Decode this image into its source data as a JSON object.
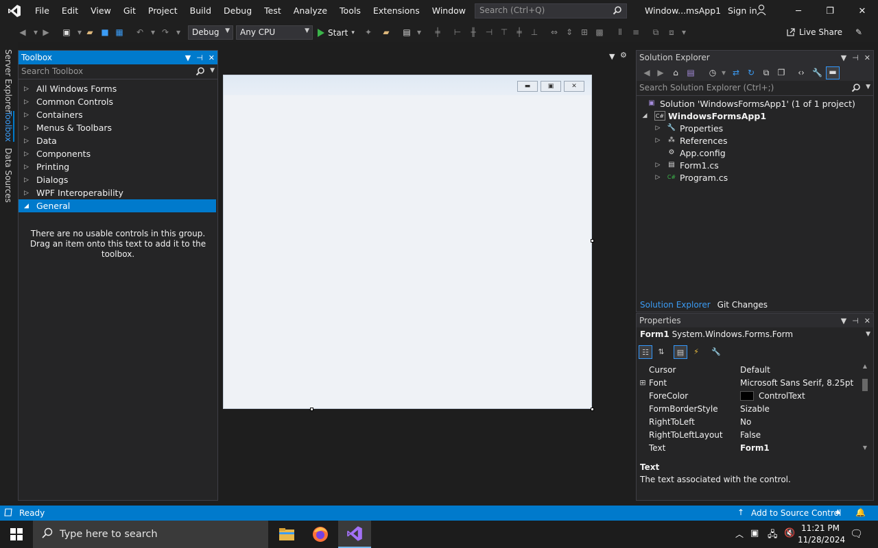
{
  "menu": {
    "items": [
      "File",
      "Edit",
      "View",
      "Git",
      "Project",
      "Build",
      "Debug",
      "Test",
      "Analyze",
      "Tools",
      "Extensions",
      "Window",
      "Help"
    ],
    "search_placeholder": "Search (Ctrl+Q)",
    "window_title": "Window...msApp1",
    "sign_in": "Sign in"
  },
  "toolbar": {
    "config": "Debug",
    "platform": "Any CPU",
    "start": "Start",
    "live_share": "Live Share"
  },
  "left_tabs": [
    "Server Explorer",
    "Toolbox",
    "Data Sources"
  ],
  "toolbox": {
    "title": "Toolbox",
    "search_placeholder": "Search Toolbox",
    "groups": [
      "All Windows Forms",
      "Common Controls",
      "Containers",
      "Menus & Toolbars",
      "Data",
      "Components",
      "Printing",
      "Dialogs",
      "WPF Interoperability"
    ],
    "selected_group": "General",
    "empty_message": "There are no usable controls in this group. Drag an item onto this text to add it to the toolbox."
  },
  "solution_explorer": {
    "title": "Solution Explorer",
    "search_placeholder": "Search Solution Explorer (Ctrl+;)",
    "solution": "Solution 'WindowsFormsApp1' (1 of 1 project)",
    "project": "WindowsFormsApp1",
    "items": [
      "Properties",
      "References",
      "App.config",
      "Form1.cs",
      "Program.cs"
    ],
    "tabs": [
      "Solution Explorer",
      "Git Changes"
    ]
  },
  "properties": {
    "title": "Properties",
    "object_name": "Form1",
    "object_type": "System.Windows.Forms.Form",
    "rows": [
      {
        "name": "Cursor",
        "value": "Default"
      },
      {
        "name": "Font",
        "value": "Microsoft Sans Serif, 8.25pt"
      },
      {
        "name": "ForeColor",
        "value": "ControlText"
      },
      {
        "name": "FormBorderStyle",
        "value": "Sizable"
      },
      {
        "name": "RightToLeft",
        "value": "No"
      },
      {
        "name": "RightToLeftLayout",
        "value": "False"
      },
      {
        "name": "Text",
        "value": "Form1"
      }
    ],
    "desc_title": "Text",
    "desc_text": "The text associated with the control."
  },
  "status": {
    "ready": "Ready",
    "source_control": "Add to Source Control"
  },
  "taskbar": {
    "search_placeholder": "Type here to search",
    "time": "11:21 PM",
    "date": "11/28/2024"
  },
  "colors": {
    "accent": "#007acc",
    "background": "#1e1e1e",
    "panel": "#252526",
    "vs_purple": "#68217a"
  }
}
